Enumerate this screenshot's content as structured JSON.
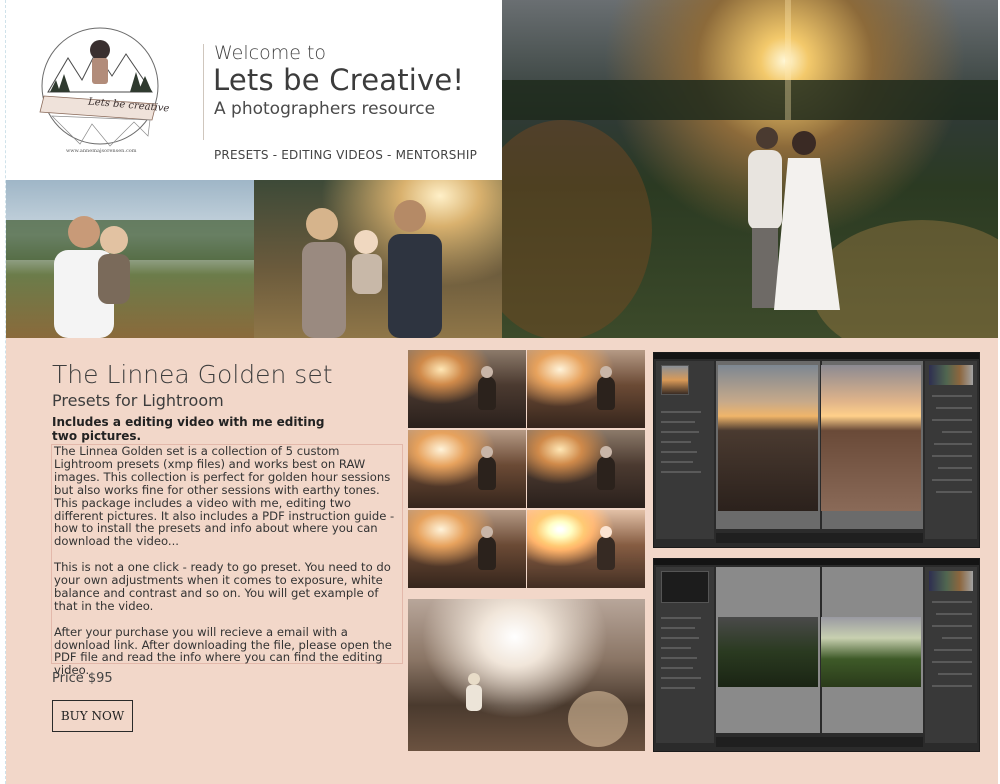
{
  "header": {
    "logo_text": "Lets be creative",
    "logo_url_text": "www.annemajsorensen.com",
    "welcome": "Welcome to",
    "title": "Lets be Creative!",
    "tagline": "A photographers resource",
    "nav": "PRESETS - EDITING VIDEOS - MENTORSHIP"
  },
  "product": {
    "title": "The Linnea Golden set",
    "subtitle": "Presets for Lightroom",
    "includes": "Includes a editing video with me editing two pictures.",
    "paragraphs": [
      "The Linnea Golden set is a collection of 5 custom Lightroom presets (xmp files) and works best on RAW images. This collection is perfect for golden hour sessions but also works fine for other sessions with earthy tones. This package includes a video with me, editing two different pictures. It also includes a PDF instruction guide - how to install the presets and info about where you can download the video...",
      "This is not a one click - ready to go preset. You need to do your own adjustments when it comes to exposure, white balance and contrast and so on. You will get example of that in the video.",
      "After your purchase you will recieve a email with a download link. After downloading the file, please open the PDF file and read the info where you can find the editing video."
    ],
    "price": "Price $95",
    "buy_label": "BUY NOW"
  },
  "colors": {
    "product_bg": "#f2d7c9",
    "accent_border": "#e3b8aa",
    "text_dark": "#3d3d3d"
  }
}
